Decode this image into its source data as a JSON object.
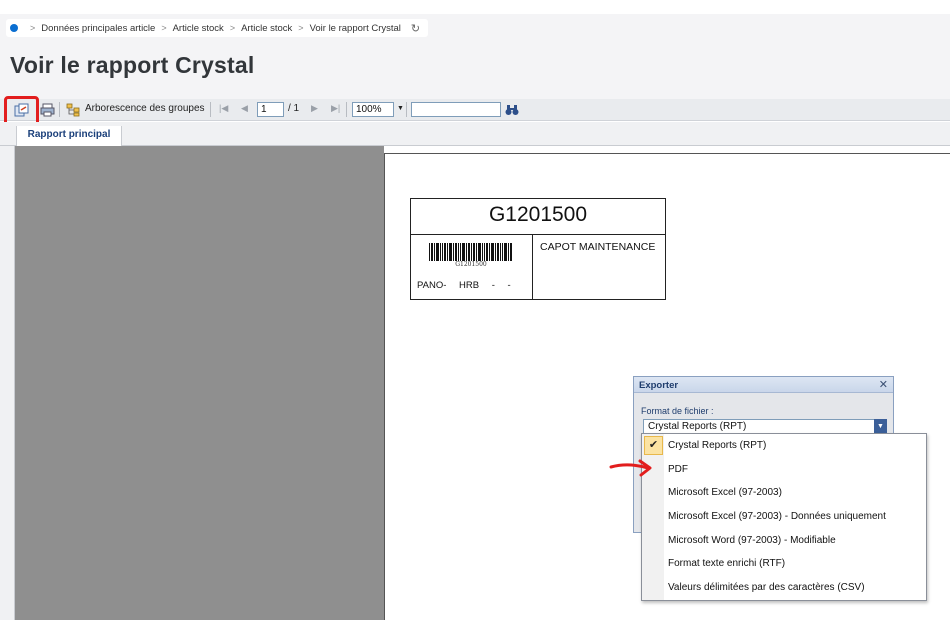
{
  "breadcrumb": {
    "items": [
      "Données principales article",
      "Article stock",
      "Article stock",
      "Voir le rapport Crystal"
    ]
  },
  "page": {
    "title": "Voir le rapport Crystal"
  },
  "toolbar": {
    "group_tree_label": "Arborescence des groupes",
    "page_current": "1",
    "page_total": "/ 1",
    "zoom": "100%",
    "search_value": ""
  },
  "tabs": {
    "main_report": "Rapport principal"
  },
  "label": {
    "code": "G1201500",
    "barcode_text": "G1201500",
    "line": "PANO- HRB - -",
    "description": "CAPOT MAINTENANCE"
  },
  "export_dialog": {
    "title": "Exporter",
    "format_label": "Format de fichier :",
    "selected": "Crystal Reports (RPT)",
    "options": [
      "Crystal Reports (RPT)",
      "PDF",
      "Microsoft Excel (97-2003)",
      "Microsoft Excel (97-2003) - Données uniquement",
      "Microsoft Word (97-2003) - Modifiable",
      "Format texte enrichi (RTF)",
      "Valeurs délimitées par des caractères (CSV)"
    ]
  },
  "colors": {
    "accent": "#0a6ed1",
    "highlight": "#e21d1d",
    "report_background": "#8f8f8f"
  }
}
